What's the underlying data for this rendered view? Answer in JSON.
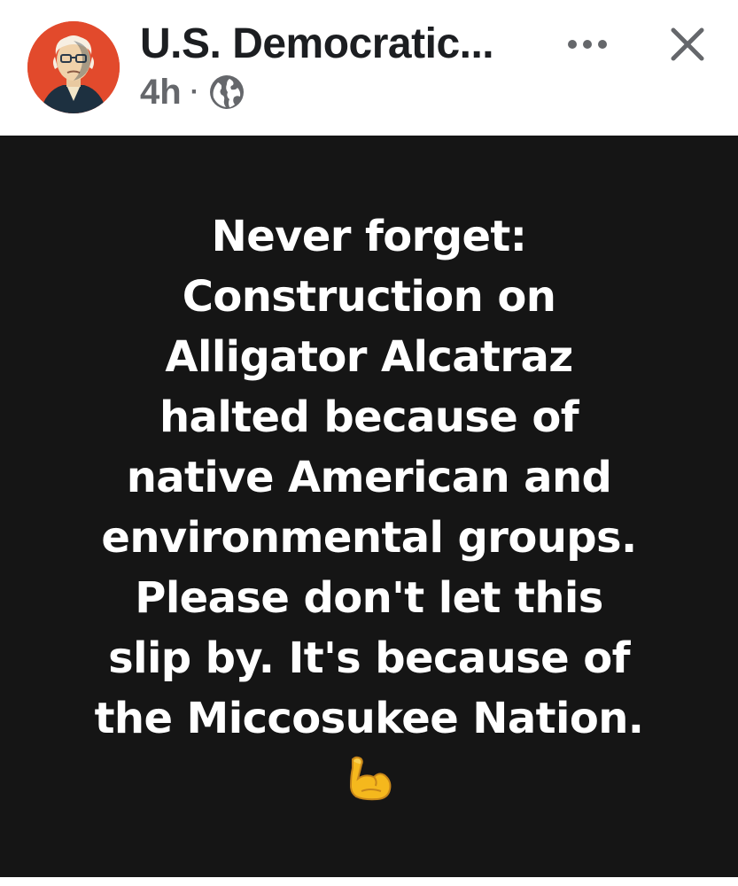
{
  "header": {
    "page_name": "U.S. Democratic...",
    "timestamp": "4h",
    "separator": "·",
    "privacy_icon": "globe-icon",
    "avatar_icon": "profile-portrait",
    "more_icon": "more-options-icon",
    "close_icon": "close-icon"
  },
  "post": {
    "background_color": "#151515",
    "text_color": "#ffffff",
    "lines": [
      "Never forget:",
      "Construction on",
      "Alligator Alcatraz",
      "halted because of",
      "native American and",
      "environmental groups.",
      "Please don't let this",
      "slip by. It's because of",
      "the Miccosukee Nation."
    ],
    "emoji": "flexed-biceps-icon"
  }
}
